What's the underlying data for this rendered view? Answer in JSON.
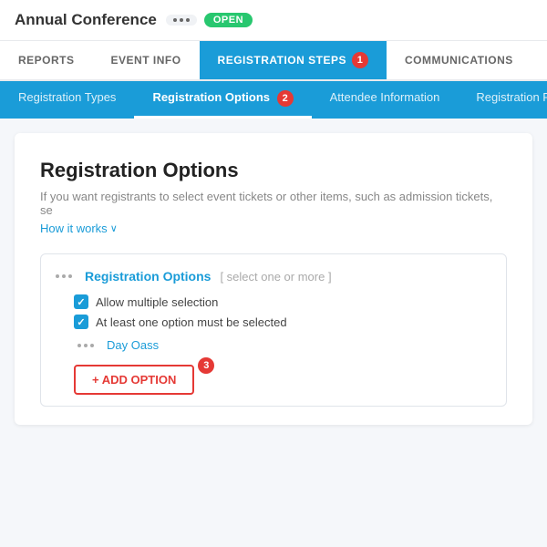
{
  "app": {
    "title": "Annual Conference",
    "status": "OPEN"
  },
  "main_nav": {
    "items": [
      {
        "id": "reports",
        "label": "REPORTS",
        "active": false
      },
      {
        "id": "event-info",
        "label": "EVENT INFO",
        "active": false
      },
      {
        "id": "registration-steps",
        "label": "REGISTRATION STEPS",
        "active": true,
        "badge": "1"
      },
      {
        "id": "communications",
        "label": "COMMUNICATIONS",
        "active": false
      }
    ]
  },
  "sub_nav": {
    "items": [
      {
        "id": "reg-types",
        "label": "Registration Types",
        "active": false
      },
      {
        "id": "reg-options",
        "label": "Registration Options",
        "active": true,
        "badge": "2"
      },
      {
        "id": "attendee-info",
        "label": "Attendee Information",
        "active": false
      },
      {
        "id": "reg-pay",
        "label": "Registration Pay",
        "active": false
      }
    ]
  },
  "content": {
    "title": "Registration Options",
    "description": "If you want registrants to select event tickets or other items, such as admission tickets, se",
    "how_it_works": "How it works",
    "options_card": {
      "title": "Registration Options",
      "hint": "[ select one or more ]",
      "checkboxes": [
        {
          "label": "Allow multiple selection",
          "checked": true
        },
        {
          "label": "At least one option must be selected",
          "checked": true
        }
      ],
      "day_item": "Day Oass",
      "add_button": "+ ADD OPTION",
      "add_badge": "3"
    }
  }
}
